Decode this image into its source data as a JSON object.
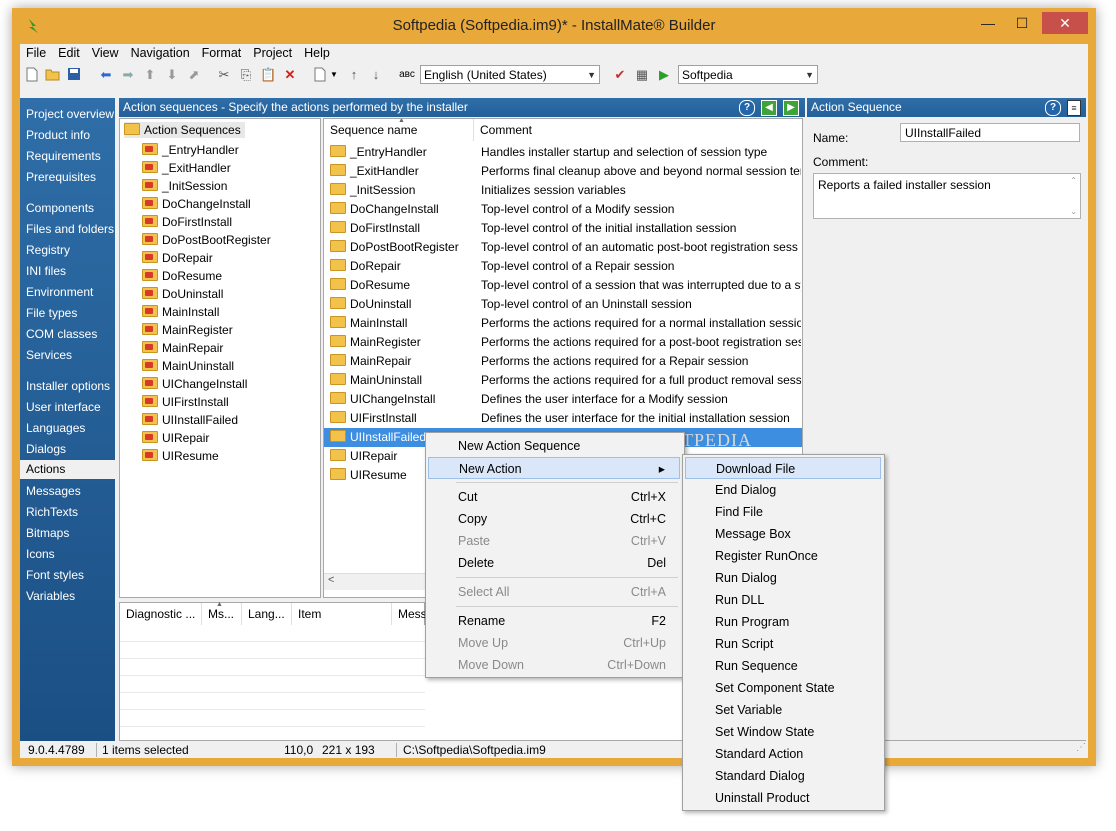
{
  "window": {
    "title": "Softpedia (Softpedia.im9)* - InstallMate® Builder",
    "min": "—",
    "max": "☐",
    "close": "✕"
  },
  "menu": [
    "File",
    "Edit",
    "View",
    "Navigation",
    "Format",
    "Project",
    "Help"
  ],
  "toolbar": {
    "language": "English (United States)",
    "project": "Softpedia",
    "abc": "aвc"
  },
  "nav": {
    "groups": [
      [
        "Project overview",
        "Product info",
        "Requirements",
        "Prerequisites"
      ],
      [
        "Components",
        "Files and folders",
        "Registry",
        "INI files",
        "Environment",
        "File types",
        "COM classes",
        "Services"
      ],
      [
        "Installer options",
        "User interface",
        "Languages",
        "Dialogs",
        "Actions",
        "Messages",
        "RichTexts",
        "Bitmaps",
        "Icons",
        "Font styles",
        "Variables"
      ]
    ],
    "selected": "Actions"
  },
  "center_header": "Action sequences - Specify the actions performed by the installer",
  "tree": {
    "root": "Action Sequences",
    "items": [
      "_EntryHandler",
      "_ExitHandler",
      "_InitSession",
      "DoChangeInstall",
      "DoFirstInstall",
      "DoPostBootRegister",
      "DoRepair",
      "DoResume",
      "DoUninstall",
      "MainInstall",
      "MainRegister",
      "MainRepair",
      "MainUninstall",
      "UIChangeInstall",
      "UIFirstInstall",
      "UIInstallFailed",
      "UIRepair",
      "UIResume"
    ]
  },
  "list": {
    "col1": "Sequence name",
    "col2": "Comment",
    "rows": [
      {
        "name": "_EntryHandler",
        "comment": "Handles installer startup and selection of session type"
      },
      {
        "name": "_ExitHandler",
        "comment": "Performs final cleanup above and beyond normal session ter..."
      },
      {
        "name": "_InitSession",
        "comment": "Initializes session variables"
      },
      {
        "name": "DoChangeInstall",
        "comment": "Top-level control of a Modify session"
      },
      {
        "name": "DoFirstInstall",
        "comment": "Top-level control of the initial installation session"
      },
      {
        "name": "DoPostBootRegister",
        "comment": "Top-level control of an automatic post-boot registration sess"
      },
      {
        "name": "DoRepair",
        "comment": "Top-level control of a Repair session"
      },
      {
        "name": "DoResume",
        "comment": "Top-level control of a session that was interrupted due to a sy"
      },
      {
        "name": "DoUninstall",
        "comment": "Top-level control of an Uninstall session"
      },
      {
        "name": "MainInstall",
        "comment": "Performs the actions required for a normal installation session"
      },
      {
        "name": "MainRegister",
        "comment": "Performs the actions required for a post-boot registration ses"
      },
      {
        "name": "MainRepair",
        "comment": "Performs the actions required for a Repair session"
      },
      {
        "name": "MainUninstall",
        "comment": "Performs the actions required for a full product removal sessi"
      },
      {
        "name": "UIChangeInstall",
        "comment": "Defines the user interface for a Modify session"
      },
      {
        "name": "UIFirstInstall",
        "comment": "Defines the user interface for the initial installation session"
      },
      {
        "name": "UIInstallFailed",
        "comment": ""
      },
      {
        "name": "UIRepair",
        "comment": ""
      },
      {
        "name": "UIResume",
        "comment": ""
      }
    ],
    "selected_index": 15
  },
  "diag": {
    "cols": [
      "Diagnostic ...",
      "Ms...",
      "Lang...",
      "Item",
      "Mess"
    ]
  },
  "right": {
    "header": "Action Sequence",
    "name_label": "Name:",
    "name_value": "UIInstallFailed",
    "comment_label": "Comment:",
    "comment_value": "Reports a failed installer session"
  },
  "context_menu": [
    {
      "label": "New Action Sequence",
      "shortcut": "",
      "disabled": false
    },
    {
      "label": "New Action",
      "shortcut": "▸",
      "disabled": false,
      "highlight": true
    },
    {
      "sep": true
    },
    {
      "label": "Cut",
      "shortcut": "Ctrl+X",
      "disabled": false
    },
    {
      "label": "Copy",
      "shortcut": "Ctrl+C",
      "disabled": false
    },
    {
      "label": "Paste",
      "shortcut": "Ctrl+V",
      "disabled": true
    },
    {
      "label": "Delete",
      "shortcut": "Del",
      "disabled": false
    },
    {
      "sep": true
    },
    {
      "label": "Select All",
      "shortcut": "Ctrl+A",
      "disabled": true
    },
    {
      "sep": true
    },
    {
      "label": "Rename",
      "shortcut": "F2",
      "disabled": false
    },
    {
      "label": "Move Up",
      "shortcut": "Ctrl+Up",
      "disabled": true
    },
    {
      "label": "Move Down",
      "shortcut": "Ctrl+Down",
      "disabled": true
    }
  ],
  "submenu": [
    "Download File",
    "End Dialog",
    "Find File",
    "Message Box",
    "Register RunOnce",
    "Run Dialog",
    "Run DLL",
    "Run Program",
    "Run Script",
    "Run Sequence",
    "Set Component State",
    "Set Variable",
    "Set Window State",
    "Standard Action",
    "Standard Dialog",
    "Uninstall Product"
  ],
  "status": {
    "version": "9.0.4.4789",
    "selection": "1 items selected",
    "pos": "110,0",
    "size": "221 x 193",
    "path": "C:\\Softpedia\\Softpedia.im9"
  },
  "watermark": "SOFTPEDIA"
}
